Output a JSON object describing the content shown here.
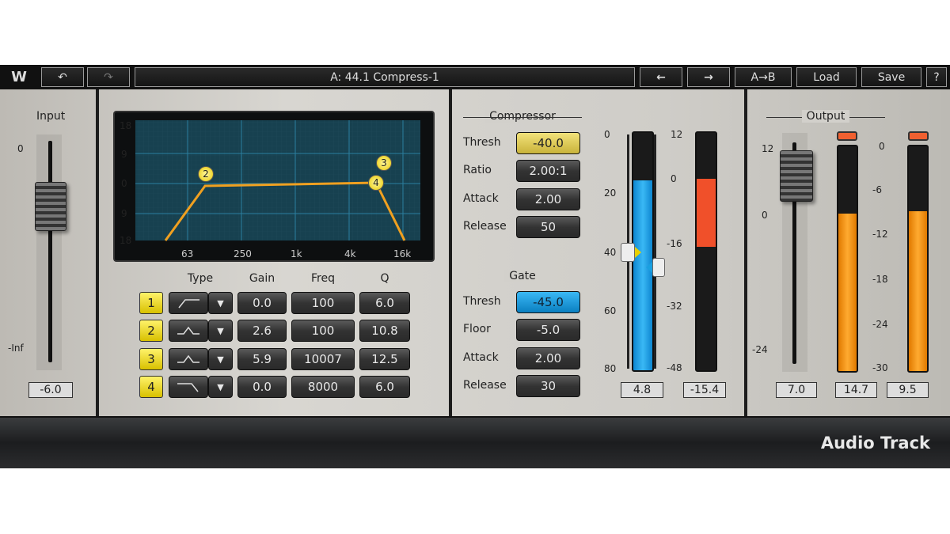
{
  "toolbar": {
    "logo": "W",
    "undo": "↶",
    "redo": "↷",
    "preset": "A: 44.1 Compress-1",
    "prev": "←",
    "next": "→",
    "ab": "A→B",
    "load": "Load",
    "save": "Save",
    "help": "?"
  },
  "input": {
    "label": "Input",
    "scale": [
      "0",
      "-Inf"
    ],
    "readout": "-6.0"
  },
  "eq": {
    "y_ticks": [
      "18",
      "9",
      "0",
      "9",
      "18"
    ],
    "x_ticks": [
      "63",
      "250",
      "1k",
      "4k",
      "16k"
    ],
    "nodes": [
      "2",
      "3",
      "4"
    ],
    "headers": {
      "type": "Type",
      "gain": "Gain",
      "freq": "Freq",
      "q": "Q"
    },
    "bands": [
      {
        "n": "1",
        "type": "high-pass",
        "gain": "0.0",
        "freq": "100",
        "q": "6.0"
      },
      {
        "n": "2",
        "type": "bell",
        "gain": "2.6",
        "freq": "100",
        "q": "10.8"
      },
      {
        "n": "3",
        "type": "bell",
        "gain": "5.9",
        "freq": "10007",
        "q": "12.5"
      },
      {
        "n": "4",
        "type": "low-pass",
        "gain": "0.0",
        "freq": "8000",
        "q": "6.0"
      }
    ]
  },
  "compressor": {
    "title": "Compressor",
    "rows": [
      {
        "label": "Thresh",
        "value": "-40.0"
      },
      {
        "label": "Ratio",
        "value": "2.00:1"
      },
      {
        "label": "Attack",
        "value": "2.00"
      },
      {
        "label": "Release",
        "value": "50"
      }
    ]
  },
  "gate": {
    "title": "Gate",
    "rows": [
      {
        "label": "Thresh",
        "value": "-45.0"
      },
      {
        "label": "Floor",
        "value": "-5.0"
      },
      {
        "label": "Attack",
        "value": "2.00"
      },
      {
        "label": "Release",
        "value": "30"
      }
    ]
  },
  "dyn_meters": {
    "left_scale": [
      "0",
      "20",
      "40",
      "60",
      "80"
    ],
    "right_scale": [
      "12",
      "0",
      "-16",
      "-32",
      "-48"
    ],
    "level_readout": "4.8",
    "gr_readout": "-15.4",
    "level_fill_pct": 80,
    "gr_fill_range": [
      0,
      -15.4
    ]
  },
  "output": {
    "label": "Output",
    "fader_scale": [
      "12",
      "0",
      "-24"
    ],
    "meter_scale": [
      "0",
      "-6",
      "-12",
      "-18",
      "-24",
      "-30"
    ],
    "fader_readout": "7.0",
    "left_readout": "14.7",
    "right_readout": "9.5",
    "left_fill_pct": 70,
    "right_fill_pct": 71
  },
  "footer": {
    "title": "Audio Track"
  },
  "colors": {
    "accent_yellow": "#e8d24a",
    "gate_blue": "#1aa0e0",
    "meter_orange": "#f39a1a",
    "gr_red": "#f0502a",
    "curve": "#f0a020"
  }
}
